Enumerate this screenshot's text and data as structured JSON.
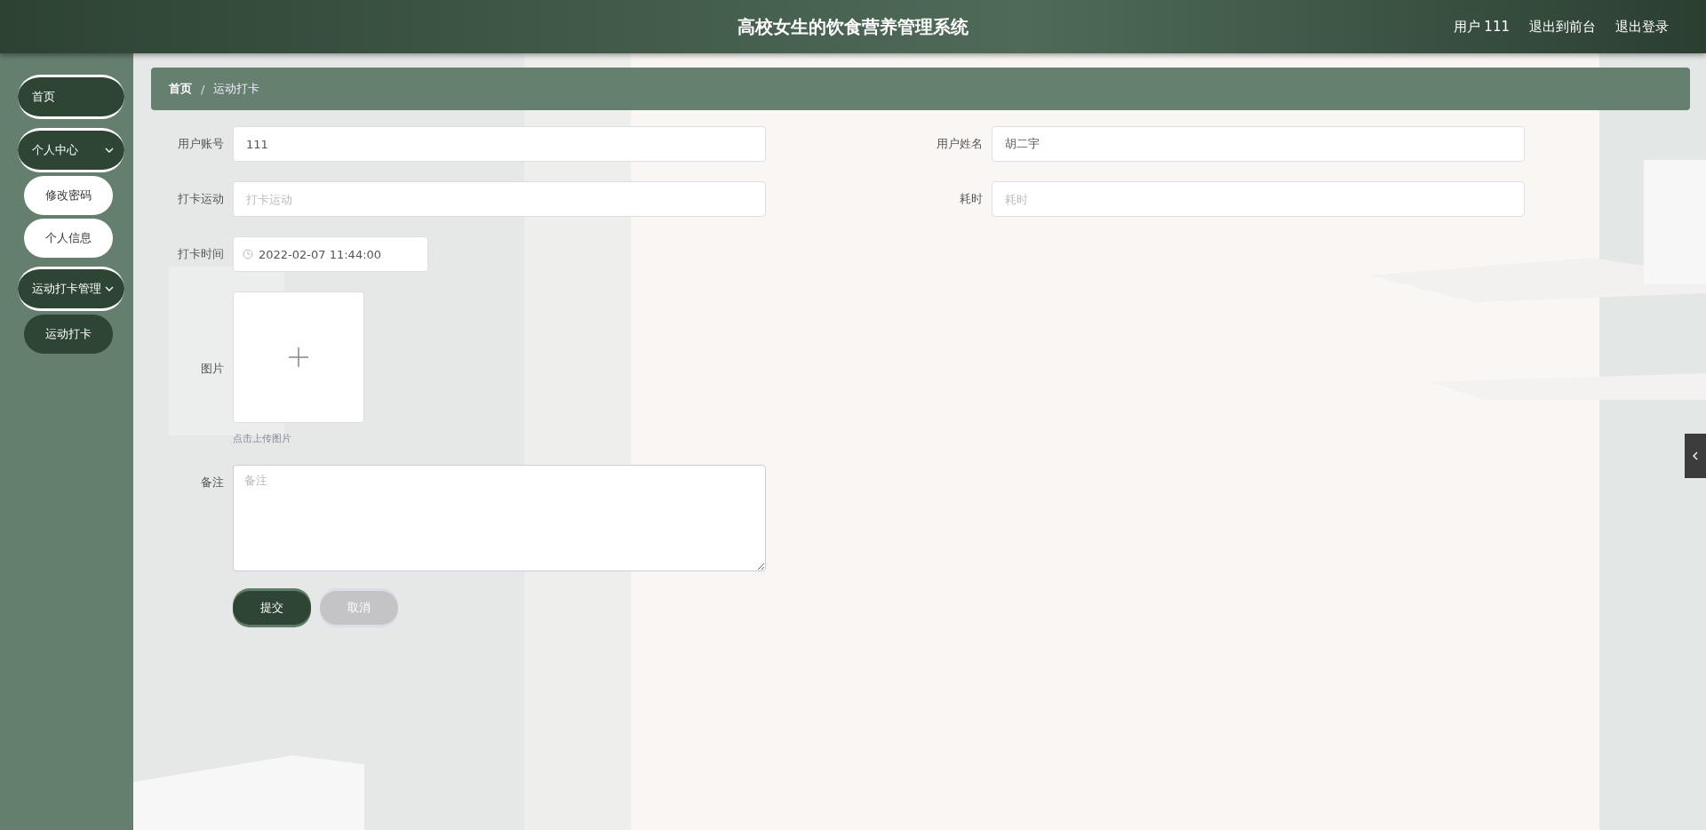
{
  "header": {
    "title": "高校女生的饮食营养管理系统",
    "links": [
      {
        "label": "用户 111"
      },
      {
        "label": "退出到前台"
      },
      {
        "label": "退出登录"
      }
    ]
  },
  "sidebar": {
    "items": [
      {
        "label": "首页"
      },
      {
        "label": "个人中心",
        "expanded": true,
        "children": [
          {
            "label": "修改密码",
            "selected": false
          },
          {
            "label": "个人信息",
            "selected": false
          }
        ]
      },
      {
        "label": "运动打卡管理",
        "expanded": true,
        "children": [
          {
            "label": "运动打卡",
            "selected": true
          }
        ]
      }
    ]
  },
  "breadcrumb": {
    "separator": "/",
    "items": [
      "首页",
      "运动打卡"
    ]
  },
  "form": {
    "rows": [
      [
        {
          "kind": "text",
          "label": "用户账号",
          "value": "111"
        },
        {
          "kind": "text",
          "label": "用户姓名",
          "value": "胡二宇"
        }
      ],
      [
        {
          "kind": "text",
          "label": "打卡运动",
          "placeholder": "打卡运动"
        },
        {
          "kind": "text",
          "label": "耗时",
          "placeholder": "耗时"
        }
      ],
      [
        {
          "kind": "datetime",
          "label": "打卡时间",
          "value": "2022-02-07 11:44:00"
        }
      ],
      [
        {
          "label": "图片",
          "hint": "点击上传图片"
        }
      ],
      [
        {
          "kind": "textarea",
          "label": "备注",
          "placeholder": "备注"
        }
      ]
    ],
    "buttons": [
      {
        "label": "提交",
        "kind": "primary"
      },
      {
        "label": "取消",
        "kind": "secondary"
      }
    ]
  }
}
